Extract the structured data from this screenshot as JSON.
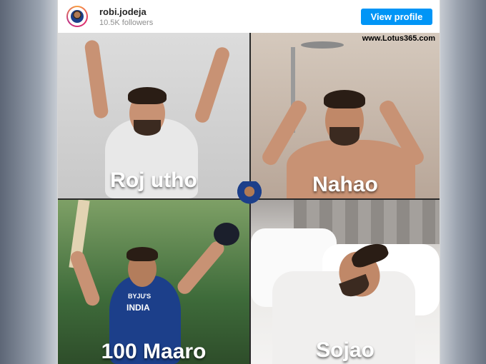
{
  "header": {
    "username": "robi.jodeja",
    "followers": "10.5K followers",
    "view_profile_label": "View profile"
  },
  "meme": {
    "watermark": "www.Lotus365.com",
    "panels": [
      {
        "caption": "Roj utho"
      },
      {
        "caption": "Nahao"
      },
      {
        "caption": "100 Maaro"
      },
      {
        "caption": "Sojao"
      }
    ],
    "jersey_text": "INDIA",
    "jersey_sponsor": "BYJU'S"
  },
  "colors": {
    "button": "#0095f6",
    "caption": "#ffffff",
    "jersey": "#1c3f8a"
  }
}
